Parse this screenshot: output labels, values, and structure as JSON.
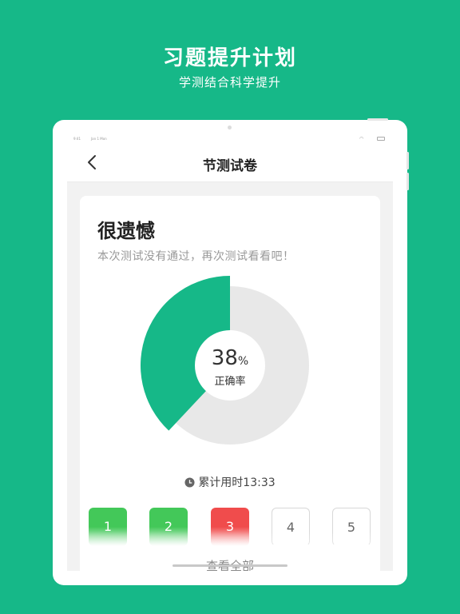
{
  "hero": {
    "title": "习题提升计划",
    "subtitle": "学测结合科学提升"
  },
  "statusbar": {
    "time": "9:41",
    "date": "Jan 1 Mon",
    "wifi_icon": "wifi-icon",
    "battery_icon": "battery-icon"
  },
  "navbar": {
    "title": "节测试卷",
    "back_icon": "chevron-left-icon"
  },
  "result": {
    "title": "很遗憾",
    "description": "本次测试没有通过，再次测试看看吧！",
    "accuracy_value": "38",
    "accuracy_unit": "%",
    "accuracy_label": "正确率",
    "accuracy_fraction": 0.38,
    "time_label": "累计用时13:33",
    "clock_icon": "clock-icon"
  },
  "answers": [
    {
      "label": "1",
      "status": "correct"
    },
    {
      "label": "2",
      "status": "correct"
    },
    {
      "label": "3",
      "status": "wrong"
    },
    {
      "label": "4",
      "status": "unanswered"
    },
    {
      "label": "5",
      "status": "unanswered"
    }
  ],
  "view_all_label": "查看全部",
  "colors": {
    "brand": "#16b888",
    "correct": "#43c859",
    "wrong": "#f04c4c",
    "ring_bg": "#e8e8e8"
  }
}
